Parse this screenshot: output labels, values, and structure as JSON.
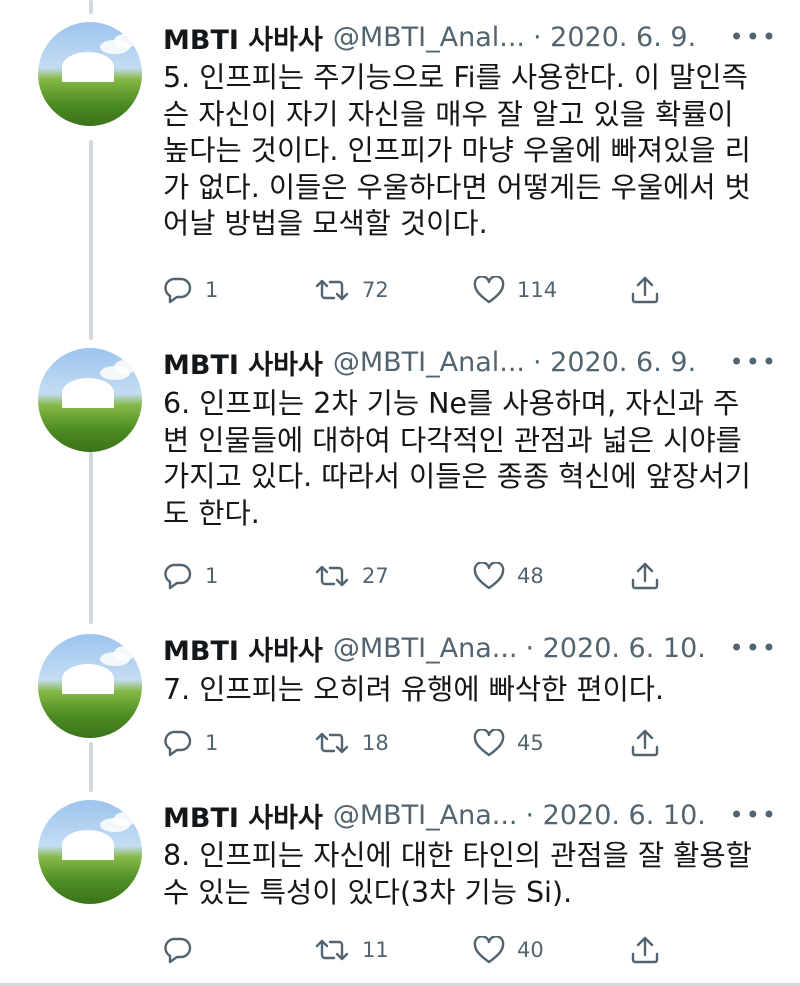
{
  "tweets": [
    {
      "name": "MBTI 사바사",
      "handle": "@MBTI_Anal...",
      "date": "· 2020. 6. 9.",
      "text": "5. 인프피는 주기능으로 Fi를 사용한다. 이 말인즉\n슨 자신이 자기 자신을 매우 잘 알고 있을 확률이\n높다는 것이다. 인프피가 마냥 우울에 빠져있을 리\n가 없다. 이들은 우울하다면 어떻게든 우울에서 벗\n어날 방법을 모색할 것이다.",
      "replies": "1",
      "retweets": "72",
      "likes": "114"
    },
    {
      "name": "MBTI 사바사",
      "handle": "@MBTI_Anal...",
      "date": "· 2020. 6. 9.",
      "text": "6. 인프피는 2차 기능 Ne를 사용하며, 자신과 주\n변 인물들에 대하여 다각적인 관점과 넓은 시야를\n가지고 있다. 따라서 이들은 종종 혁신에 앞장서기\n도 한다.",
      "replies": "1",
      "retweets": "27",
      "likes": "48"
    },
    {
      "name": "MBTI 사바사",
      "handle": "@MBTI_Ana...",
      "date": "· 2020. 6. 10.",
      "text": "7. 인프피는 오히려 유행에 빠삭한 편이다.",
      "replies": "1",
      "retweets": "18",
      "likes": "45"
    },
    {
      "name": "MBTI 사바사",
      "handle": "@MBTI_Ana...",
      "date": "· 2020. 6. 10.",
      "text": "8. 인프피는 자신에 대한 타인의 관점을 잘 활용할\n수 있는 특성이 있다(3차 기능 Si).",
      "replies": "",
      "retweets": "11",
      "likes": "40"
    }
  ],
  "icons": {
    "reply": "reply-icon",
    "retweet": "retweet-icon",
    "like": "heart-icon",
    "share": "share-icon",
    "more": "more-icon"
  },
  "colors": {
    "text": "#14171a",
    "secondary": "#536471",
    "thread_line": "#cfd9de"
  }
}
